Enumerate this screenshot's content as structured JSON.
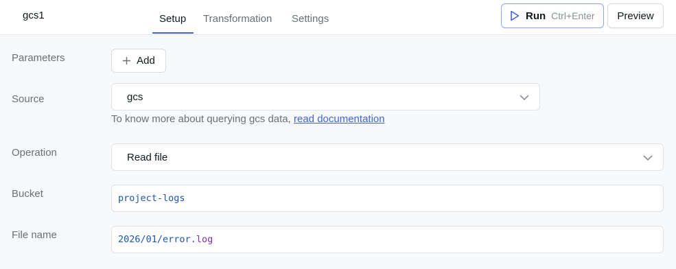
{
  "header": {
    "query_name": "gcs1",
    "tabs": [
      {
        "label": "Setup",
        "active": true
      },
      {
        "label": "Transformation",
        "active": false
      },
      {
        "label": "Settings",
        "active": false
      }
    ],
    "run_label": "Run",
    "run_shortcut": "Ctrl+Enter",
    "preview_label": "Preview"
  },
  "form": {
    "parameters": {
      "label": "Parameters",
      "add_label": "Add"
    },
    "source": {
      "label": "Source",
      "value": "gcs",
      "help_prefix": "To know more about querying gcs data, ",
      "help_link": "read documentation"
    },
    "operation": {
      "label": "Operation",
      "value": "Read file"
    },
    "bucket": {
      "label": "Bucket",
      "value": "project-logs"
    },
    "file_name": {
      "label": "File name",
      "value_part1": "2026/01/error",
      "value_part2": ".",
      "value_part3": "log"
    }
  },
  "colors": {
    "accent": "#3e63dd",
    "background": "#f8f9fa"
  }
}
